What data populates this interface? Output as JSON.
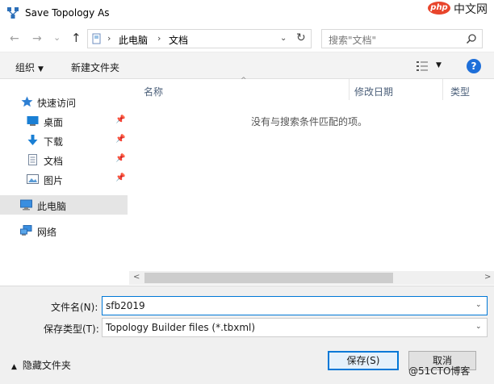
{
  "window": {
    "title": "Save Topology As",
    "watermark_php": "php",
    "watermark_cn": "中文网",
    "watermark_51": "@51CTO博客"
  },
  "nav": {
    "back": "←",
    "forward": "→",
    "dropdown": "⌄",
    "up": "↑",
    "path": [
      "此电脑",
      "文档"
    ],
    "path_separator": "›",
    "refresh": "↻",
    "search_placeholder": "搜索\"文档\""
  },
  "toolbar": {
    "organize": "组织",
    "new_folder": "新建文件夹",
    "help": "?"
  },
  "sidebar": {
    "items": [
      {
        "label": "快速访问",
        "icon": "star-icon"
      },
      {
        "label": "桌面",
        "icon": "desktop-icon",
        "pinned": true
      },
      {
        "label": "下载",
        "icon": "download-icon",
        "pinned": true
      },
      {
        "label": "文档",
        "icon": "document-icon",
        "pinned": true
      },
      {
        "label": "图片",
        "icon": "picture-icon",
        "pinned": true
      },
      {
        "label": "此电脑",
        "icon": "computer-icon",
        "selected": true
      },
      {
        "label": "网络",
        "icon": "network-icon"
      }
    ],
    "pin_glyph": "📌"
  },
  "filelist": {
    "columns": [
      "名称",
      "修改日期",
      "类型"
    ],
    "empty_message": "没有与搜索条件匹配的项。",
    "sort_glyph": "^"
  },
  "scrollbar": {
    "left": "<",
    "right": ">"
  },
  "form": {
    "filename_label": "文件名(N):",
    "filename_value": "sfb2019",
    "filetype_label": "保存类型(T):",
    "filetype_value": "Topology Builder files (*.tbxml)"
  },
  "footer": {
    "hide_folders": "隐藏文件夹",
    "save": "保存(S)",
    "cancel": "取消"
  },
  "colors": {
    "accent": "#0078d7",
    "help": "#1e6fd9",
    "selected_row": "#e5e5e5"
  }
}
